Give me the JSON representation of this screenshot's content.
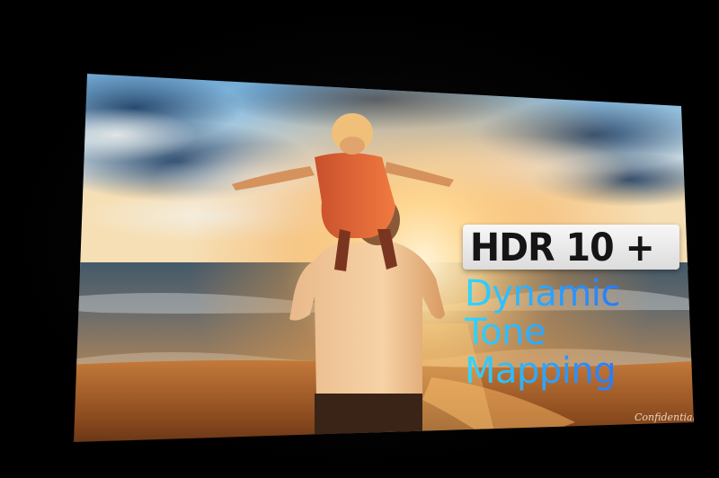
{
  "slide": {
    "headline": "HDR 10 +",
    "subtitle_lines": [
      "Dynamic",
      "Tone",
      "Mapping"
    ],
    "watermark": "Confidential"
  },
  "colors": {
    "background": "#000000",
    "headline_text": "#151515",
    "headline_badge": "#eeeeee",
    "subtitle_gradient_start": "#30d8ff",
    "subtitle_gradient_end": "#1f5cff",
    "sky": "#6fa8d8",
    "sun_glow": "#ffc060",
    "sea": "#2a3b4a",
    "sand": "#8a4a1e"
  }
}
